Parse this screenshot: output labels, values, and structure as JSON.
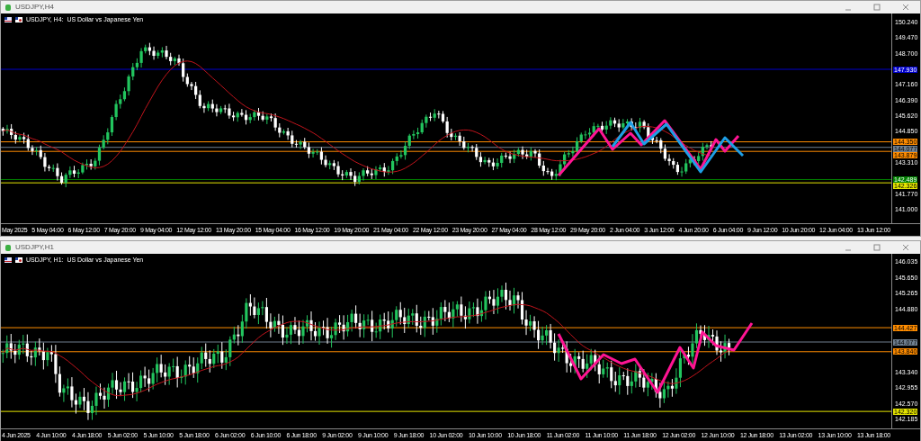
{
  "windows": [
    {
      "title": "USDJPY,H4",
      "chart_label": "USDJPY, H4:  US Dollar vs Japanese Yen",
      "price_ticks": [
        "150.240",
        "149.470",
        "148.700",
        "147.160",
        "146.390",
        "145.620",
        "144.850",
        "143.310",
        "141.770",
        "141.000"
      ],
      "price_tags": [
        {
          "text": "147.930",
          "color": "#0000cc"
        },
        {
          "text": "144.350",
          "color": "#ff8c00"
        },
        {
          "text": "144.077",
          "color": "#708090"
        },
        {
          "text": "143.879",
          "color": "#ff8c00"
        },
        {
          "text": "142.489",
          "color": "#008000"
        },
        {
          "text": "142.326",
          "color": "#e6e600"
        }
      ],
      "time_labels": [
        "May 2025",
        "5 May 04:00",
        "6 May 12:00",
        "7 May 20:00",
        "9 May 04:00",
        "12 May 12:00",
        "13 May 20:00",
        "15 May 04:00",
        "16 May 12:00",
        "19 May 20:00",
        "21 May 04:00",
        "22 May 12:00",
        "23 May 20:00",
        "27 May 04:00",
        "28 May 12:00",
        "29 May 20:00",
        "2 Jun 04:00",
        "3 Jun 12:00",
        "4 Jun 20:00",
        "6 Jun 04:00",
        "9 Jun 12:00",
        "10 Jun 20:00",
        "12 Jun 04:00",
        "13 Jun 12:00"
      ]
    },
    {
      "title": "USDJPY,H1",
      "chart_label": "USDJPY, H1:  US Dollar vs Japanese Yen",
      "price_ticks": [
        "146.035",
        "145.650",
        "145.265",
        "144.880",
        "143.340",
        "142.955",
        "142.570",
        "142.185"
      ],
      "price_tags": [
        {
          "text": "144.427",
          "color": "#ff8c00"
        },
        {
          "text": "144.077",
          "color": "#708090"
        },
        {
          "text": "143.840",
          "color": "#ff8c00"
        },
        {
          "text": "142.320",
          "color": "#e6e600"
        }
      ],
      "time_labels": [
        "4 Jun 2025",
        "4 Jun 10:00",
        "4 Jun 18:00",
        "5 Jun 02:00",
        "5 Jun 10:00",
        "5 Jun 18:00",
        "6 Jun 02:00",
        "6 Jun 10:00",
        "6 Jun 18:00",
        "9 Jun 02:00",
        "9 Jun 10:00",
        "9 Jun 18:00",
        "10 Jun 02:00",
        "10 Jun 10:00",
        "10 Jun 18:00",
        "11 Jun 02:00",
        "11 Jun 10:00",
        "11 Jun 18:00",
        "12 Jun 02:00",
        "12 Jun 10:00",
        "12 Jun 18:00",
        "13 Jun 02:00",
        "13 Jun 10:00",
        "13 Jun 18:00"
      ]
    }
  ]
}
